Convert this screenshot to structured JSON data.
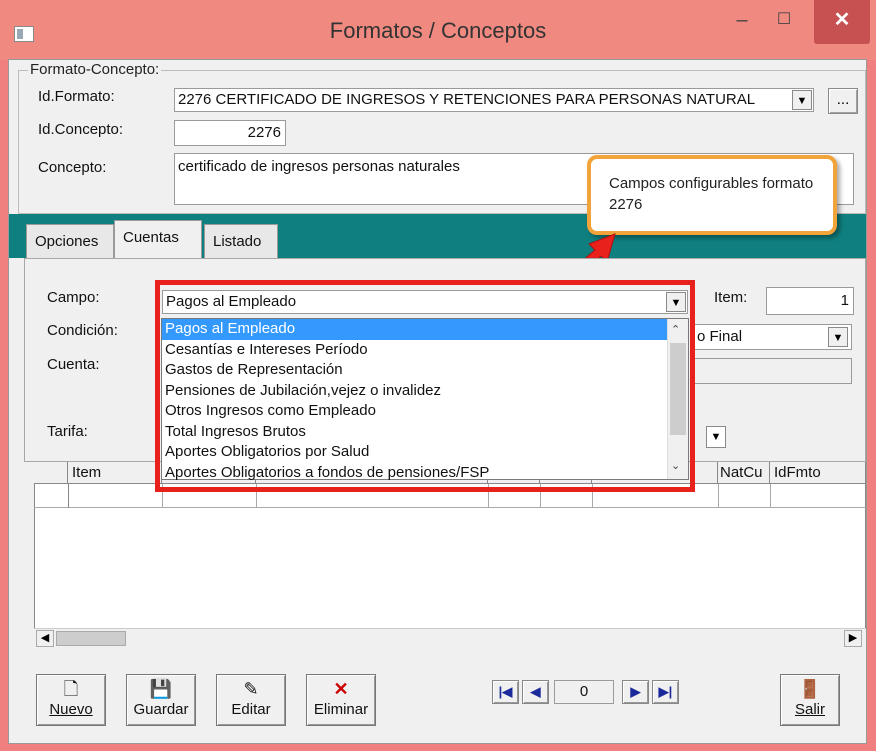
{
  "window": {
    "title": "Formatos / Conceptos",
    "minimize": "–",
    "maximize": "☐",
    "close": "✕"
  },
  "group": {
    "label": "Formato-Concepto:",
    "id_formato_label": "Id.Formato:",
    "id_formato_value": "2276 CERTIFICADO DE INGRESOS Y RETENCIONES PARA PERSONAS NATURAL",
    "browse_label": "...",
    "id_concepto_label": "Id.Concepto:",
    "id_concepto_value": "2276",
    "concepto_label": "Concepto:",
    "concepto_value": "certificado de ingresos personas naturales"
  },
  "callout": {
    "text": "Campos configurables formato 2276",
    "color": "#f2a33a"
  },
  "tabs": [
    {
      "label": "Opciones"
    },
    {
      "label": "Cuentas"
    },
    {
      "label": "Listado"
    }
  ],
  "form": {
    "campo_label": "Campo:",
    "campo_value": "Pagos al Empleado",
    "item_label": "Item:",
    "item_value": "1",
    "condicion_label": "Condición:",
    "condicion_value": "o Final",
    "cuenta_label": "Cuenta:",
    "tarifa_label": "Tarifa:"
  },
  "dropdown": {
    "options": [
      "Pagos al Empleado",
      "Cesantías e Intereses Período",
      "Gastos de Representación",
      "Pensiones de Jubilación,vejez o invalidez",
      "Otros Ingresos como Empleado",
      "Total Ingresos Brutos",
      "Aportes Obligatorios por Salud",
      "Aportes Obligatorios a fondos de pensiones/FSP"
    ],
    "selected_index": 0,
    "highlight_color": "#e8211d"
  },
  "grid": {
    "columns": [
      "Item",
      "",
      "",
      "",
      "",
      "",
      "NatCu",
      "IdFmto"
    ]
  },
  "toolbar": {
    "nuevo": "Nuevo",
    "guardar": "Guardar",
    "editar": "Editar",
    "eliminar": "Eliminar",
    "record": "0",
    "salir": "Salir"
  }
}
